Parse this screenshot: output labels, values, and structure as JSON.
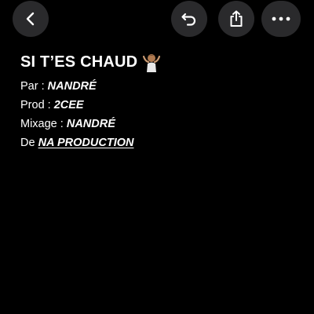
{
  "toolbar": {
    "back_icon": "chevron-left-icon",
    "undo_icon": "undo-icon",
    "share_icon": "share-icon",
    "more_icon": "ellipsis-icon",
    "button_color": "#2a2a2c"
  },
  "note": {
    "title": "SI T’ES CHAUD",
    "title_emoji": "person-shrugging-emoji",
    "lines": [
      {
        "label": "Par : ",
        "value": "NANDRÉ"
      },
      {
        "label": "Prod : ",
        "value": "2CEE"
      },
      {
        "label": "Mixage : ",
        "value": "NANDRÉ"
      },
      {
        "label": "De ",
        "value": "NA PRODUCTION"
      }
    ]
  },
  "colors": {
    "background": "#000000",
    "text": "#ffffff"
  }
}
